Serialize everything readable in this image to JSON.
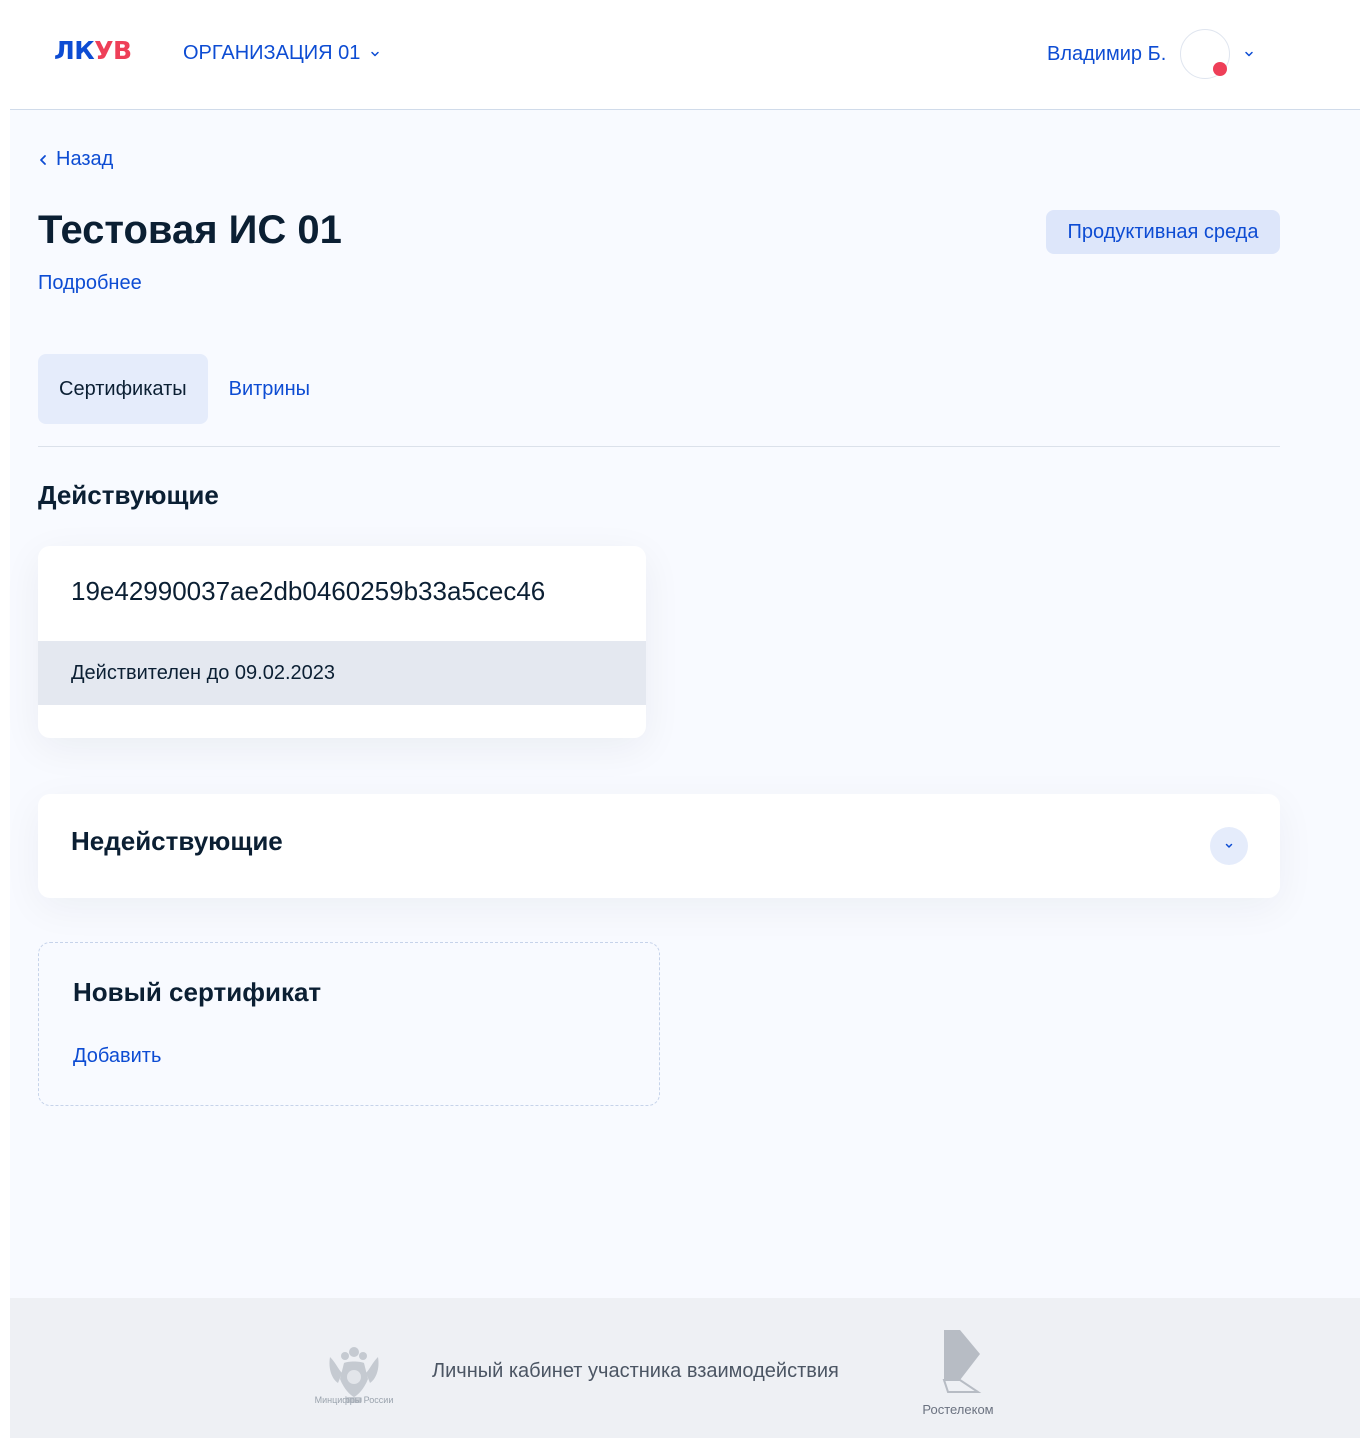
{
  "header": {
    "logo_part1": "ЛК",
    "logo_part2": "УВ",
    "organization": "ОРГАНИЗАЦИЯ 01",
    "user_name": "Владимир Б."
  },
  "nav": {
    "back_label": "Назад"
  },
  "page": {
    "title": "Тестовая ИС 01",
    "details_link": "Подробнее",
    "environment_badge": "Продуктивная среда"
  },
  "tabs": [
    {
      "label": "Сертификаты",
      "active": true
    },
    {
      "label": "Витрины",
      "active": false
    }
  ],
  "active_section": {
    "title": "Действующие",
    "certificates": [
      {
        "id": "19e42990037ae2db0460259b33a5cec46",
        "validity": "Действителен до 09.02.2023"
      }
    ]
  },
  "inactive_section": {
    "title": "Недействующие",
    "expanded": false
  },
  "new_certificate": {
    "title": "Новый сертификат",
    "add_label": "Добавить"
  },
  "footer": {
    "ministry_label": "Минцифры России",
    "text": "Личный кабинет участника взаимодействия",
    "partner_label": "Ростелеком"
  },
  "colors": {
    "accent": "#0d4cd3",
    "logo_red": "#ee3f58",
    "text": "#0b1f33",
    "background": "#f8faff",
    "badge_bg": "#dde6fa"
  }
}
